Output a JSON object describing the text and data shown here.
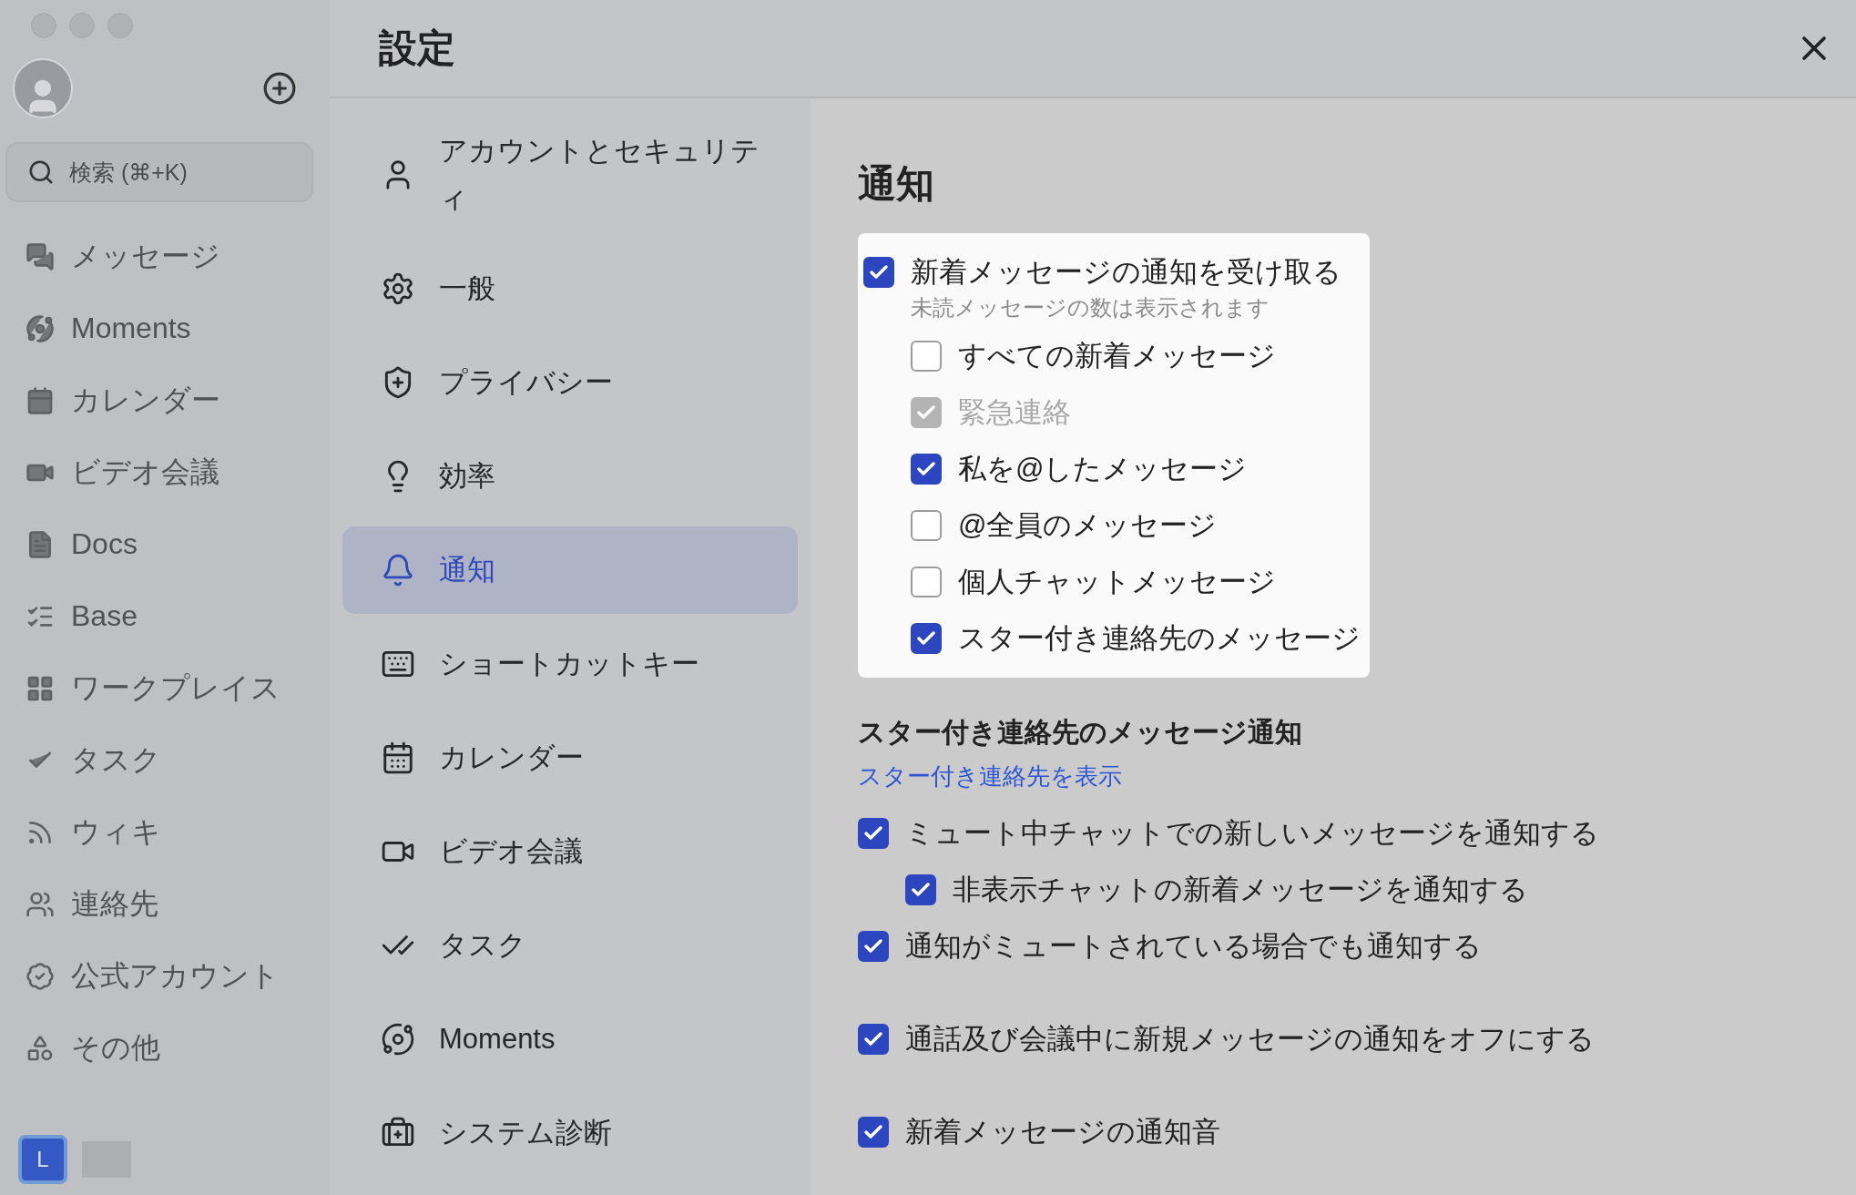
{
  "sidebar": {
    "search": {
      "placeholder": "検索 (⌘+K)"
    },
    "items": [
      {
        "label": "メッセージ"
      },
      {
        "label": "Moments"
      },
      {
        "label": "カレンダー"
      },
      {
        "label": "ビデオ会議"
      },
      {
        "label": "Docs"
      },
      {
        "label": "Base"
      },
      {
        "label": "ワークプレイス"
      },
      {
        "label": "タスク"
      },
      {
        "label": "ウィキ"
      },
      {
        "label": "連絡先"
      },
      {
        "label": "公式アカウント"
      },
      {
        "label": "その他"
      }
    ],
    "app_tile": "L"
  },
  "settings": {
    "title": "設定",
    "nav": [
      {
        "label": "アカウントとセキュリティ",
        "selected": false
      },
      {
        "label": "一般",
        "selected": false
      },
      {
        "label": "プライバシー",
        "selected": false
      },
      {
        "label": "効率",
        "selected": false
      },
      {
        "label": "通知",
        "selected": true
      },
      {
        "label": "ショートカットキー",
        "selected": false
      },
      {
        "label": "カレンダー",
        "selected": false
      },
      {
        "label": "ビデオ会議",
        "selected": false
      },
      {
        "label": "タスク",
        "selected": false
      },
      {
        "label": "Moments",
        "selected": false
      },
      {
        "label": "システム診断",
        "selected": false
      }
    ],
    "heading": "通知",
    "main_option": {
      "label": "新着メッセージの通知を受け取る",
      "checked": true,
      "note": "未読メッセージの数は表示されます",
      "children": [
        {
          "label": "すべての新着メッセージ",
          "checked": false,
          "disabled": false
        },
        {
          "label": "緊急連絡",
          "checked": true,
          "disabled": true
        },
        {
          "label": "私を@したメッセージ",
          "checked": true,
          "disabled": false
        },
        {
          "label": "@全員のメッセージ",
          "checked": false,
          "disabled": false
        },
        {
          "label": "個人チャットメッセージ",
          "checked": false,
          "disabled": false
        },
        {
          "label": "スター付き連絡先のメッセージ",
          "checked": true,
          "disabled": false
        }
      ]
    },
    "starred": {
      "title": "スター付き連絡先のメッセージ通知",
      "link": "スター付き連絡先を表示"
    },
    "groups": [
      [
        {
          "label": "ミュート中チャットでの新しいメッセージを通知する",
          "checked": true,
          "children": [
            {
              "label": "非表示チャットの新着メッセージを通知する",
              "checked": true
            }
          ]
        },
        {
          "label": "通知がミュートされている場合でも通知する",
          "checked": true
        }
      ],
      [
        {
          "label": "通話及び会議中に新規メッセージの通知をオフにする",
          "checked": true
        }
      ],
      [
        {
          "label": "新着メッセージの通知音",
          "checked": true
        }
      ]
    ]
  }
}
